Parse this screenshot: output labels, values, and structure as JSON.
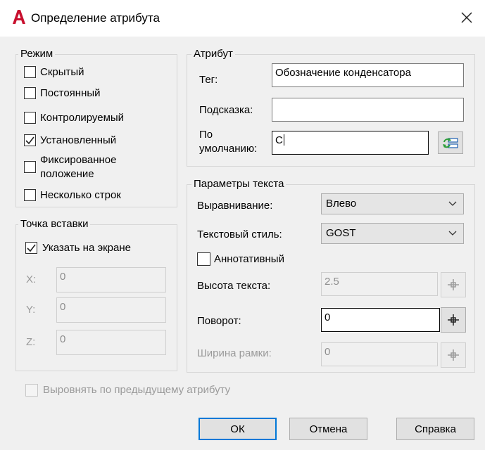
{
  "dialog": {
    "title": "Определение атрибута"
  },
  "mode": {
    "legend": "Режим",
    "items": [
      {
        "label": "Скрытый",
        "checked": false
      },
      {
        "label": "Постоянный",
        "checked": false
      },
      {
        "label": "Контролируемый",
        "checked": false
      },
      {
        "label": "Установленный",
        "checked": true
      },
      {
        "label_line1": "Фиксированное",
        "label_line2": "положение",
        "checked": false
      },
      {
        "label": "Несколько строк",
        "checked": false
      }
    ]
  },
  "insertion": {
    "legend": "Точка вставки",
    "specify_on_screen": "Указать на экране",
    "x_label": "X:",
    "x_value": "0",
    "y_label": "Y:",
    "y_value": "0",
    "z_label": "Z:",
    "z_value": "0"
  },
  "attribute": {
    "legend": "Атрибут",
    "tag_label": "Тег:",
    "tag_value": "Обозначение конденсатора",
    "prompt_label": "Подсказка:",
    "prompt_value": "",
    "default_label_line1": "По",
    "default_label_line2": "умолчанию:",
    "default_value": "С"
  },
  "text_params": {
    "legend": "Параметры текста",
    "justify_label": "Выравнивание:",
    "justify_value": "Влево",
    "style_label": "Текстовый стиль:",
    "style_value": "GOST",
    "annotative_label": "Аннотативный",
    "height_label": "Высота текста:",
    "height_value": "2.5",
    "rotation_label": "Поворот:",
    "rotation_value": "0",
    "width_label": "Ширина рамки:",
    "width_value": "0"
  },
  "align_prev": "Выровнять по предыдущему атрибуту",
  "buttons": {
    "ok": "ОК",
    "cancel": "Отмена",
    "help": "Справка"
  },
  "colors": {
    "accent": "#0078d7",
    "app_icon": "#c8102e"
  }
}
